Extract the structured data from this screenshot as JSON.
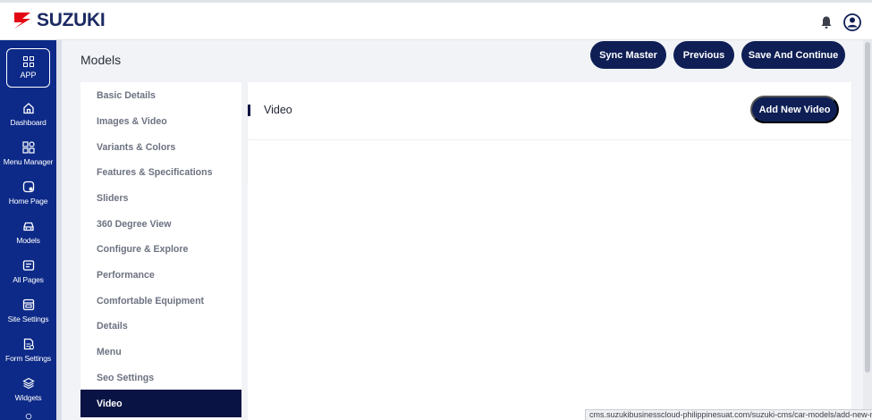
{
  "brand": {
    "name": "SUZUKI",
    "mark_color": "#e30613",
    "text_color": "#1c2a63"
  },
  "header": {
    "icons": [
      "bell-icon",
      "user-account-icon"
    ]
  },
  "sidebar": {
    "app_label": "APP",
    "items": [
      {
        "label": "Dashboard",
        "icon": "home-icon"
      },
      {
        "label": "Menu Manager",
        "icon": "grid-icon"
      },
      {
        "label": "Home Page",
        "icon": "home-page-icon"
      },
      {
        "label": "Models",
        "icon": "car-icon"
      },
      {
        "label": "All Pages",
        "icon": "pages-icon"
      },
      {
        "label": "Site Settings",
        "icon": "site-settings-icon"
      },
      {
        "label": "Form Settings",
        "icon": "form-icon"
      },
      {
        "label": "Widgets",
        "icon": "layers-icon"
      }
    ],
    "color": "#0d2a88"
  },
  "page": {
    "title": "Models"
  },
  "toolbar": {
    "sync_label": "Sync Master",
    "previous_label": "Previous",
    "save_label": "Save And Continue"
  },
  "menu": {
    "items": [
      "Basic Details",
      "Images & Video",
      "Variants & Colors",
      "Features & Specifications",
      "Sliders",
      "360 Degree View",
      "Configure & Explore",
      "Performance",
      "Comfortable Equipment",
      "Details",
      "Menu",
      "Seo Settings",
      "Video"
    ],
    "active_index": 12
  },
  "content": {
    "title": "Video",
    "add_label": "Add New Video"
  },
  "status": {
    "url": "cms.suzukibusinesscloud-philippinesuat.com/suzuki-cms/car-models/add-new-m..."
  },
  "colors": {
    "button": "#0f1f55",
    "active_menu": "#0a1444"
  }
}
